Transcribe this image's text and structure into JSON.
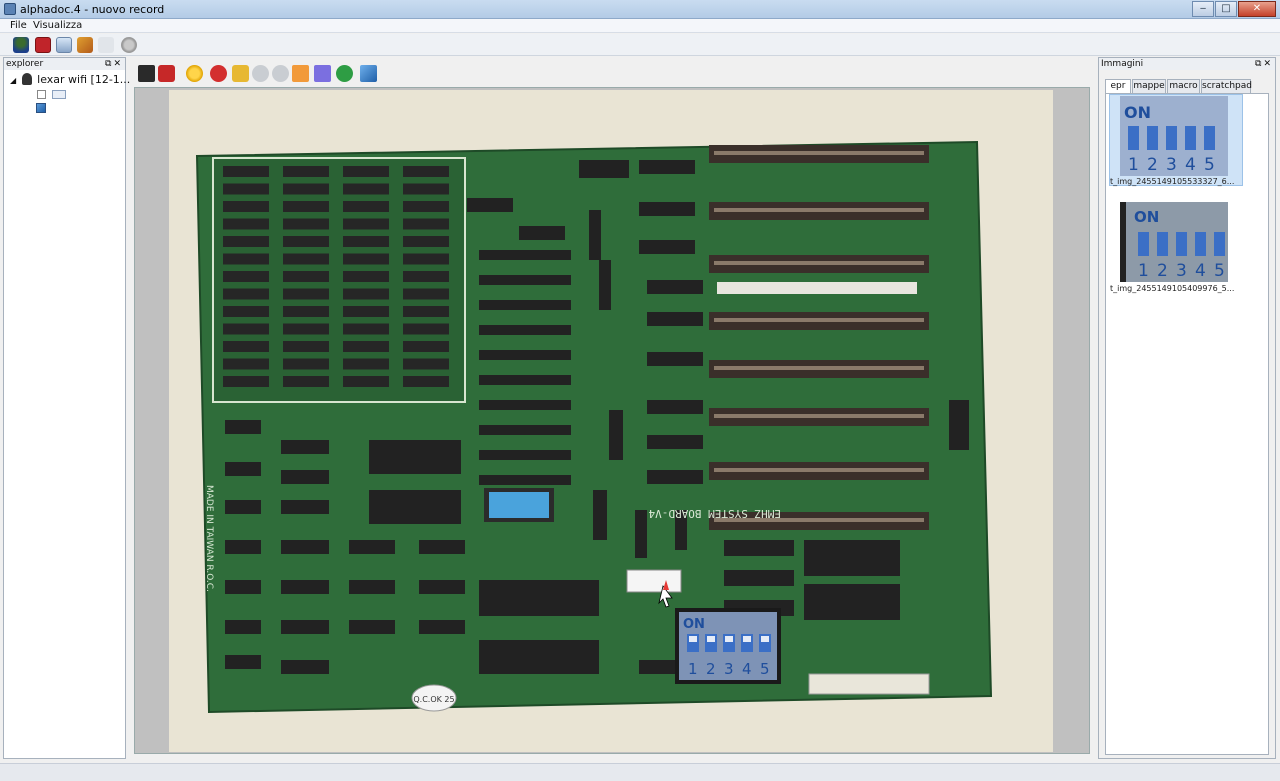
{
  "window": {
    "title": "alphadoc.4 - nuovo record"
  },
  "menu": {
    "items": [
      "File",
      "Visualizza"
    ]
  },
  "explorer": {
    "title": "explorer",
    "root_label": "lexar wifi [12-1..."
  },
  "images_panel": {
    "title": "Immagini",
    "tabs": [
      "epr",
      "mappe",
      "macro",
      "scratchpad"
    ],
    "active_tab": "epr",
    "thumbnails": [
      {
        "label": "t_img_2455149105533327_6...",
        "dip_label": "ON",
        "dip_numbers": [
          "1",
          "2",
          "3",
          "4",
          "5"
        ]
      },
      {
        "label": "t_img_2455149105409976_5...",
        "dip_label": "ON",
        "dip_numbers": [
          "1",
          "2",
          "3",
          "4",
          "5"
        ]
      }
    ]
  },
  "board": {
    "silkscreen_model": "EMHZ SYSTEM BOARD-V4",
    "silkscreen_origin": "MADE IN TAIWAN R.O.C.",
    "qc_sticker": "Q.C.OK 25",
    "inset_dip_label": "ON",
    "inset_dip_numbers": [
      "1",
      "2",
      "3",
      "4",
      "5"
    ]
  },
  "colors": {
    "pcb": "#2f6d3a",
    "dip_blue": "#3b6fc6",
    "accent": "#1f5fa8"
  }
}
